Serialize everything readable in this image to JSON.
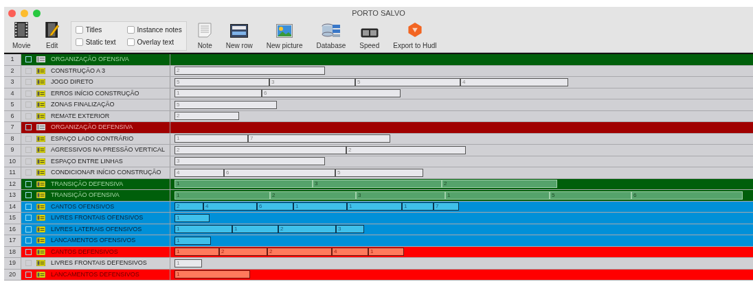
{
  "window": {
    "title": "PORTO SALVO"
  },
  "toolbar": {
    "left_buttons": [
      {
        "label": "Movie",
        "kind": "movie"
      },
      {
        "label": "Edit",
        "kind": "edit"
      }
    ],
    "options": [
      {
        "label": "Titles",
        "checked": false
      },
      {
        "label": "Instance notes",
        "checked": false
      },
      {
        "label": "Static text",
        "checked": false
      },
      {
        "label": "Overlay text",
        "checked": false
      }
    ],
    "buttons": [
      {
        "label": "Note",
        "kind": "note"
      },
      {
        "label": "New row",
        "kind": "row"
      },
      {
        "label": "New picture",
        "kind": "picture"
      },
      {
        "label": "Database",
        "kind": "database"
      },
      {
        "label": "Speed",
        "kind": "speed"
      },
      {
        "label": "Export to Hudl",
        "kind": "export"
      }
    ]
  },
  "rows": [
    {
      "number": "1",
      "label": "ORGANIZAÇÃO OFENSIVA",
      "kind": "header",
      "color": "#005f0b",
      "checked": false,
      "clips": []
    },
    {
      "number": "2",
      "label": "CONSTRUÇÃO A 3",
      "kind": "code",
      "color": "#d0d0d4",
      "checked": false,
      "clips": [
        "2"
      ]
    },
    {
      "number": "3",
      "label": "JOGO DIRETO",
      "kind": "code",
      "color": "#d0d0d4",
      "checked": false,
      "clips": [
        "5",
        "3",
        "5",
        "4"
      ]
    },
    {
      "number": "4",
      "label": "ERROS INÍCIO CONSTRUÇÃO",
      "kind": "code",
      "color": "#d0d0d4",
      "checked": false,
      "clips": [
        "1",
        "6"
      ]
    },
    {
      "number": "5",
      "label": "ZONAS FINALIZAÇÃO",
      "kind": "code",
      "color": "#d0d0d4",
      "checked": false,
      "clips": [
        "5"
      ]
    },
    {
      "number": "6",
      "label": "REMATE EXTERIOR",
      "kind": "code",
      "color": "#d0d0d4",
      "checked": false,
      "clips": [
        "2"
      ]
    },
    {
      "number": "7",
      "label": "ORGANIZAÇÃO DEFENSIVA",
      "kind": "header",
      "color": "#a00000",
      "checked": false,
      "clips": []
    },
    {
      "number": "8",
      "label": "ESPAÇO LADO CONTRÁRIO",
      "kind": "code",
      "color": "#d0d0d4",
      "checked": false,
      "clips": [
        "1",
        "7"
      ]
    },
    {
      "number": "9",
      "label": "AGRESSIVOS NA PRESSÃO VERTICAL",
      "kind": "code",
      "color": "#d0d0d4",
      "checked": false,
      "clips": [
        "2",
        "2"
      ]
    },
    {
      "number": "10",
      "label": "ESPAÇO ENTRE LINHAS",
      "kind": "code",
      "color": "#d0d0d4",
      "checked": false,
      "clips": [
        "3"
      ]
    },
    {
      "number": "11",
      "label": "CONDICIONAR INÍCIO CONSTRUÇÃO",
      "kind": "code",
      "color": "#d0d0d4",
      "checked": false,
      "clips": [
        "4",
        "6",
        "5"
      ]
    },
    {
      "number": "12",
      "label": "TRANSIÇÃO DEFENSIVA",
      "kind": "code",
      "color": "#005f0b",
      "checked": false,
      "clips": [
        "1",
        "3",
        "2"
      ]
    },
    {
      "number": "13",
      "label": "TRANSIÇÃO OFENSIVA",
      "kind": "code",
      "color": "#005f0b",
      "checked": false,
      "clips": [
        "1",
        "2",
        "3",
        "1",
        "5",
        "6"
      ]
    },
    {
      "number": "14",
      "label": "CANTOS  OFENSIVOS",
      "kind": "code",
      "color": "#0090d8",
      "checked": false,
      "clips": [
        "2",
        "4",
        "6",
        "1",
        "1",
        "1",
        "7"
      ]
    },
    {
      "number": "15",
      "label": "LIVRES FRONTAIS OFENSIVOS",
      "kind": "code",
      "color": "#0090d8",
      "checked": false,
      "clips": [
        "1"
      ]
    },
    {
      "number": "16",
      "label": "LIVRES LATERAIS OFENSIVOS",
      "kind": "code",
      "color": "#0090d8",
      "checked": false,
      "clips": [
        "1",
        "1",
        "2",
        "3"
      ]
    },
    {
      "number": "17",
      "label": "LANCAMENTOS OFENSIVOS",
      "kind": "code",
      "color": "#0090d8",
      "checked": false,
      "clips": [
        "1"
      ]
    },
    {
      "number": "18",
      "label": "CANTOS DEFENSIVOS",
      "kind": "code",
      "color": "#ff0000",
      "checked": false,
      "clips": [
        "1",
        "2",
        "2",
        "4",
        "1"
      ]
    },
    {
      "number": "19",
      "label": "LIVRES FRONTAIS DEFENSIVOS",
      "kind": "code",
      "color": "#d0d0d4",
      "checked": false,
      "clips": [
        "1"
      ]
    },
    {
      "number": "20",
      "label": "LANCAMENTOS DEFENSIVOS",
      "kind": "code",
      "color": "#ff0000",
      "checked": false,
      "clips": [
        "1"
      ]
    }
  ]
}
